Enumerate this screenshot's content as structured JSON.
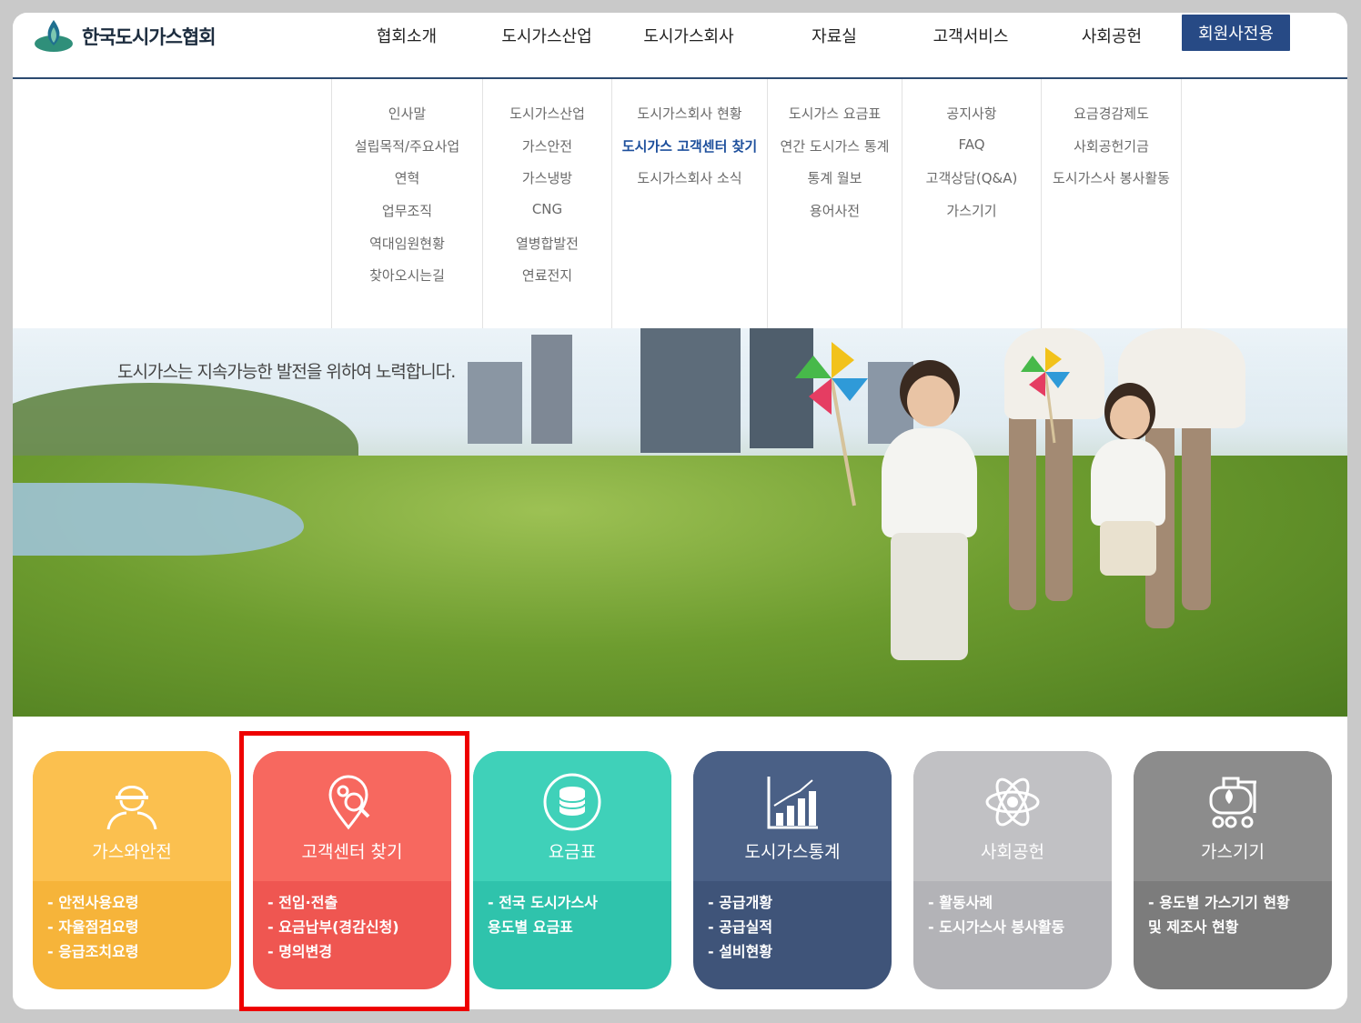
{
  "header": {
    "logo_text": "한국도시가스협회",
    "nav": [
      "협회소개",
      "도시가스산업",
      "도시가스회사",
      "자료실",
      "고객서비스",
      "사회공헌"
    ],
    "member_button": "회원사전용"
  },
  "mega_menu": {
    "columns": [
      {
        "items": [
          "인사말",
          "설립목적/주요사업",
          "연혁",
          "업무조직",
          "역대임원현황",
          "찾아오시는길"
        ]
      },
      {
        "items": [
          "도시가스산업",
          "가스안전",
          "가스냉방",
          "CNG",
          "열병합발전",
          "연료전지"
        ]
      },
      {
        "items": [
          "도시가스회사 현황",
          "도시가스 고객센터 찾기",
          "도시가스회사 소식"
        ],
        "active_index": 1
      },
      {
        "items": [
          "도시가스 요금표",
          "연간 도시가스 통계",
          "통계 월보",
          "용어사전"
        ]
      },
      {
        "items": [
          "공지사항",
          "FAQ",
          "고객상담(Q&A)",
          "가스기기"
        ]
      },
      {
        "items": [
          "요금경감제도",
          "사회공헌기금",
          "도시가스사 봉사활동"
        ]
      }
    ]
  },
  "hero": {
    "tagline": "도시가스는 지속가능한 발전을 위하여 노력합니다."
  },
  "cards": [
    {
      "title": "가스와안전",
      "lines": [
        "- 안전사용요령",
        "- 자율점검요령",
        "- 응급조치요령"
      ],
      "icon": "worker-helmet-icon",
      "color_top": "#fbc04f",
      "color_bottom": "#f6b43a"
    },
    {
      "title": "고객센터 찾기",
      "lines": [
        "- 전입·전출",
        "- 요금납부(경감신청)",
        "- 명의변경"
      ],
      "icon": "location-search-icon",
      "color_top": "#f7685f",
      "color_bottom": "#ef5651"
    },
    {
      "title": "요금표",
      "lines": [
        "- 전국 도시가스사",
        "용도별 요금표"
      ],
      "icon": "database-coin-icon",
      "color_top": "#3fd1b9",
      "color_bottom": "#2fc3ac"
    },
    {
      "title": "도시가스통계",
      "lines": [
        "- 공급개황",
        "- 공급실적",
        "- 설비현황"
      ],
      "icon": "bar-chart-icon",
      "color_top": "#4a6086",
      "color_bottom": "#3f5479"
    },
    {
      "title": "사회공헌",
      "lines": [
        "- 활동사례",
        "- 도시가스사 봉사활동"
      ],
      "icon": "atom-icon",
      "color_top": "#c1c1c4",
      "color_bottom": "#b3b3b7"
    },
    {
      "title": "가스기기",
      "lines": [
        "- 용도별 가스기기 현황",
        "및 제조사 현황"
      ],
      "icon": "tank-truck-icon",
      "color_top": "#8c8c8c",
      "color_bottom": "#7c7c7c"
    }
  ],
  "colors": {
    "brand": "#274a85",
    "highlight": "#ee0000"
  }
}
